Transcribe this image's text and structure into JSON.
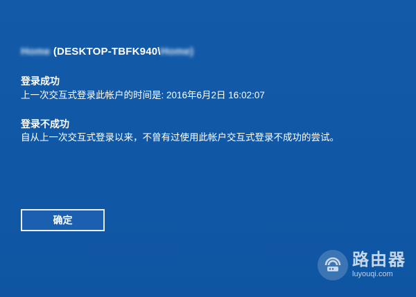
{
  "account": {
    "user_prefix": "Home",
    "computer": "(DESKTOP-TBFK940\\",
    "user_suffix": "Home)"
  },
  "success": {
    "title": "登录成功",
    "detail": "上一次交互式登录此帐户的时间是: 2016年6月2日 16:02:07"
  },
  "failure": {
    "title": "登录不成功",
    "detail": "自从上一次交互式登录以来，不曾有过使用此帐户交互式登录不成功的尝试。"
  },
  "ok_button": {
    "label": "确定"
  },
  "watermark": {
    "name": "路由器",
    "url": "luyouqi.com",
    "icon": "router-logo-icon"
  }
}
